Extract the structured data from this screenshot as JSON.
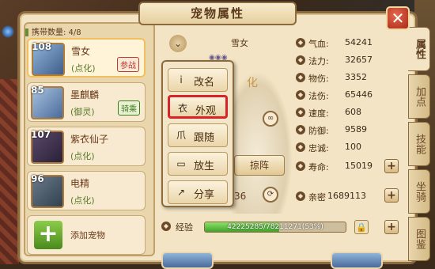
{
  "window": {
    "title": "宠物属性",
    "close_label": "✕"
  },
  "left": {
    "carry_label": "携带数量: 4/8",
    "pets": [
      {
        "level": "108",
        "name": "雪女",
        "sub": "(点化)",
        "tag": "参战",
        "tag_color": "#b8402a"
      },
      {
        "level": "85",
        "name": "墨麒麟",
        "sub": "(御灵)",
        "tag": "骑乘",
        "tag_color": "#3f7a1f"
      },
      {
        "level": "107",
        "name": "紫衣仙子",
        "sub": "(点化)",
        "tag": ""
      },
      {
        "level": "96",
        "name": "电精",
        "sub": "(点化)",
        "tag": ""
      }
    ],
    "add_label": "添加宠物"
  },
  "center": {
    "pet_name": "雪女",
    "deco_char": "化",
    "zhenfa_label": "掠阵",
    "number_36": "36"
  },
  "menu": {
    "items": [
      {
        "icon": "i",
        "label": "改名"
      },
      {
        "icon": "衣",
        "label": "外观"
      },
      {
        "icon": "爪",
        "label": "跟随"
      },
      {
        "icon": "▭",
        "label": "放生"
      },
      {
        "icon": "↗",
        "label": "分享"
      }
    ]
  },
  "stats": [
    {
      "label": "气血:",
      "value": "54241"
    },
    {
      "label": "法力:",
      "value": "32657"
    },
    {
      "label": "物伤:",
      "value": "3352"
    },
    {
      "label": "法伤:",
      "value": "65446"
    },
    {
      "label": "速度:",
      "value": "608"
    },
    {
      "label": "防御:",
      "value": "9589"
    },
    {
      "label": "忠诚:",
      "value": "100"
    },
    {
      "label": "寿命:",
      "value": "15019"
    },
    {
      "label": "亲密",
      "value": "1689113"
    }
  ],
  "exp": {
    "label": "经验",
    "text": "42225285/78211271(53%)",
    "progress": 0.53
  },
  "side_tabs": [
    "属性",
    "加点",
    "技能",
    "坐骑",
    "图鉴"
  ],
  "colors": {
    "frame": "#f2e4c4",
    "accent_red": "#d8232a",
    "exp_green": "#3ea52a"
  }
}
